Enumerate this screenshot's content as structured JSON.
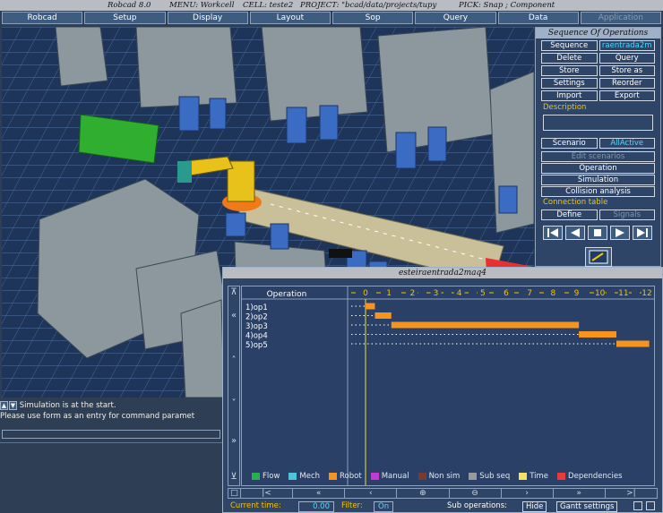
{
  "titlebar": {
    "app": "Robcad 8.0",
    "menu": "MENU: Workcell",
    "cell": "CELL: teste2",
    "project": "PROJECT: \"bcad/data/projects/tupy",
    "pick": "PICK: Snap ; Component"
  },
  "menubar": {
    "items": [
      "Robcad",
      "Setup",
      "Display",
      "Layout",
      "Sop",
      "Query",
      "Data",
      "Application"
    ]
  },
  "sop_panel": {
    "title": "Sequence Of Operations",
    "buttons": {
      "sequence": "Sequence",
      "sequence_value": "raentrada2m",
      "delete": "Delete",
      "query": "Query",
      "store": "Store",
      "store_as": "Store as",
      "settings": "Settings",
      "reorder": "Reorder",
      "import": "Import",
      "export": "Export"
    },
    "description_label": "Description",
    "description_value": "",
    "scenario": "Scenario",
    "scenario_value": "AllActive",
    "edit_scenarios": "Edit scenarios",
    "operation": "Operation",
    "simulation": "Simulation",
    "collision_analysis": "Collision analysis",
    "connection_table_label": "Connection table",
    "define": "Define",
    "signals": "Signals",
    "play_controls": [
      "skip-to-start-icon",
      "step-back-icon",
      "stop-icon",
      "play-icon",
      "skip-to-end-icon"
    ]
  },
  "status": {
    "line1": "Simulation is at the start.",
    "line2": "Please use form as an entry for command paramet",
    "command_value": ""
  },
  "gantt": {
    "window_title": "esteiraentrada2maq4",
    "column_header": "Operation",
    "legend": [
      {
        "label": "Flow",
        "color": "#22b14c"
      },
      {
        "label": "Mech",
        "color": "#4fc3d9"
      },
      {
        "label": "Robot",
        "color": "#f7941d"
      },
      {
        "label": "Manual",
        "color": "#c03ad4"
      },
      {
        "label": "Non sim",
        "color": "#7a3b2e"
      },
      {
        "label": "Sub seq",
        "color": "#9a9a9a"
      },
      {
        "label": "Time",
        "color": "#f6e05e"
      },
      {
        "label": "Dependencies",
        "color": "#e53b3b"
      }
    ],
    "current_time_label": "Current time:",
    "current_time_value": "0.00",
    "filter_label": "Filter:",
    "filter_value": "On",
    "sub_operations_label": "Sub operations:",
    "hide_button": "Hide",
    "gantt_settings_button": "Gantt settings"
  },
  "chart_data": {
    "type": "gantt",
    "x_ticks": [
      0,
      1,
      2,
      3,
      4,
      5,
      6,
      7,
      8,
      9,
      10,
      11,
      12
    ],
    "xlim": [
      0,
      12
    ],
    "rows": [
      {
        "label": "1)op1",
        "start": 0.0,
        "end": 0.4
      },
      {
        "label": "2)op2",
        "start": 0.4,
        "end": 1.1
      },
      {
        "label": "3)op3",
        "start": 1.1,
        "end": 9.1
      },
      {
        "label": "4)op4",
        "start": 9.1,
        "end": 10.7
      },
      {
        "label": "5)op5",
        "start": 10.7,
        "end": 12.1
      }
    ],
    "bar_color": "#f7941d",
    "current_time": 0.0
  }
}
